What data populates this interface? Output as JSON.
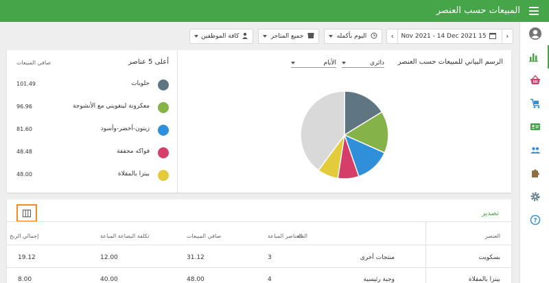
{
  "app": {
    "title": "المبيعات حسب العنصر"
  },
  "filters": {
    "date_range": "Nov 2021 - 14 Dec 2021 15",
    "time": "اليوم بأكمله",
    "stores": "جميع المتاجر",
    "employees": "كافة الموظفين"
  },
  "chart_panel": {
    "title": "الرسم البياني للمبيعات حسب العنصر",
    "type_selector": "دائري",
    "period_selector": "الأيام"
  },
  "top_items": {
    "title": "أعلى 5 عناصر",
    "net_sales_header": "صافي المبيعات",
    "items": [
      {
        "name": "حلويات",
        "value": "101.49",
        "color": "#5f7682"
      },
      {
        "name": "معكرونة لينغويني مع الأنشوجة",
        "value": "96.96",
        "color": "#85b34a"
      },
      {
        "name": "زيتون-أخضر-وأسود",
        "value": "81.60",
        "color": "#2f8fd8"
      },
      {
        "name": "فواكه مجففة",
        "value": "48.48",
        "color": "#d63e6a"
      },
      {
        "name": "بيتزا بالمقلاة",
        "value": "48.00",
        "color": "#e2cc3c"
      }
    ]
  },
  "chart_data": {
    "type": "pie",
    "values": [
      101.49,
      96.96,
      81.6,
      48.48,
      48.0,
      250.0
    ],
    "colors": [
      "#5f7682",
      "#85b34a",
      "#2f8fd8",
      "#d63e6a",
      "#e2cc3c",
      "#d9d9d9"
    ]
  },
  "table": {
    "export_label": "تصدير",
    "headers": [
      "العنصر",
      "الفئة",
      "العناصر المباعة",
      "صافي المبيعات",
      "تكلفة البضاعة المباعة",
      "إجمالي الربح"
    ],
    "rows": [
      [
        "بسكويت",
        "منتجات أخرى",
        "3",
        "31.12",
        "12.00",
        "19.12"
      ],
      [
        "بيتزا بالمقلاة",
        "وجبة رئيسية",
        "4",
        "48.00",
        "40.00",
        "8.00"
      ]
    ]
  },
  "colors": {
    "brand": "#46a548",
    "highlight": "#f08a24"
  }
}
